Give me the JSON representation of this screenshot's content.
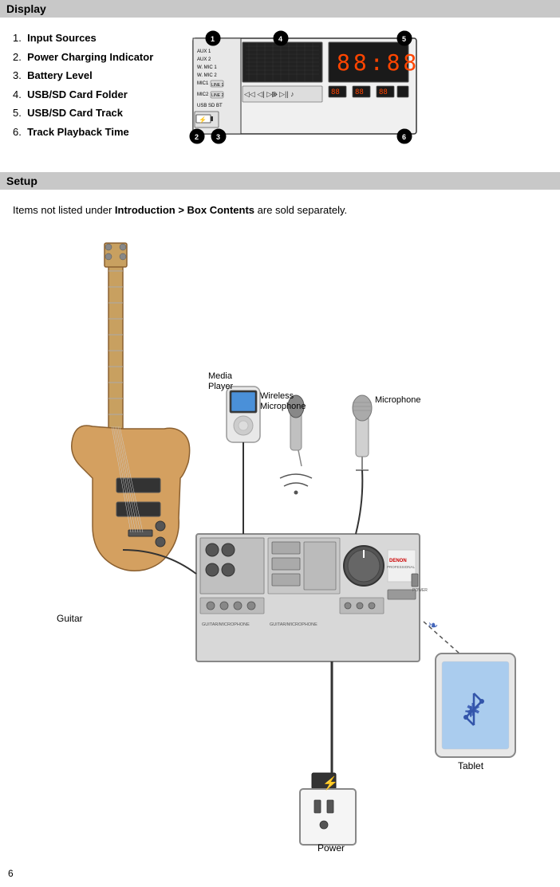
{
  "sections": {
    "display": {
      "header": "Display",
      "items": [
        {
          "number": "1",
          "label": "Input Sources"
        },
        {
          "number": "2",
          "label": "Power Charging Indicator"
        },
        {
          "number": "3",
          "label": "Battery Level"
        },
        {
          "number": "4",
          "label": "USB/SD Card Folder"
        },
        {
          "number": "5",
          "label": "USB/SD Card Track"
        },
        {
          "number": "6",
          "label": "Track Playback Time"
        }
      ]
    },
    "setup": {
      "header": "Setup",
      "intro_text": "Items not listed under ",
      "intro_bold": "Introduction > Box Contents",
      "intro_suffix": " are sold separately."
    },
    "labels": {
      "media_player": "Media Player",
      "wireless_mic": "Wireless Microphone",
      "microphone": "Microphone",
      "guitar": "Guitar",
      "tablet": "Tablet",
      "power": "Power"
    }
  },
  "page_number": "6"
}
